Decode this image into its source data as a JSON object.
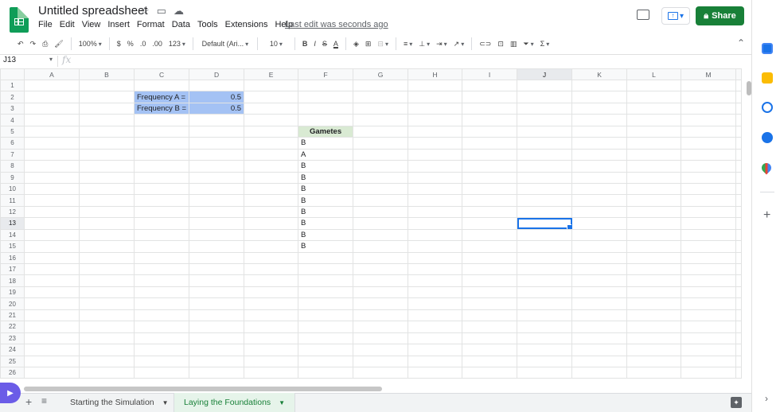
{
  "header": {
    "title": "Untitled spreadsheet",
    "menu": [
      "File",
      "Edit",
      "View",
      "Insert",
      "Format",
      "Data",
      "Tools",
      "Extensions",
      "Help"
    ],
    "last_edit": "Last edit was seconds ago",
    "share_label": "Share"
  },
  "toolbar": {
    "zoom": "100%",
    "currency": "$",
    "percent": "%",
    "decrease_decimal": ".0",
    "increase_decimal": ".00",
    "more_formats": "123",
    "font": "Default (Ari...",
    "font_size": "10",
    "bold": "B",
    "italic": "I",
    "strike": "S",
    "text_color": "A"
  },
  "formula_bar": {
    "name_box": "J13",
    "fx": "fx"
  },
  "grid": {
    "columns": [
      "A",
      "B",
      "C",
      "D",
      "E",
      "F",
      "G",
      "H",
      "I",
      "J",
      "K",
      "L",
      "M"
    ],
    "rows": [
      "1",
      "2",
      "3",
      "4",
      "5",
      "6",
      "7",
      "8",
      "9",
      "10",
      "11",
      "12",
      "13",
      "14",
      "15",
      "16",
      "17",
      "18",
      "19",
      "20",
      "21",
      "22",
      "23",
      "24",
      "25",
      "26"
    ],
    "selected_column": "J",
    "selected_row": "13",
    "cells": {
      "C2": "Frequency A =",
      "D2": "0.5",
      "C3": "Frequency B =",
      "D3": "0.5",
      "F5": "Gametes",
      "F6": "B",
      "F7": "A",
      "F8": "B",
      "F9": "B",
      "F10": "B",
      "F11": "B",
      "F12": "B",
      "F13": "B",
      "F14": "B",
      "F15": "B"
    }
  },
  "sheets": {
    "tabs": [
      {
        "label": "Starting the Simulation",
        "active": false
      },
      {
        "label": "Laying the Foundations",
        "active": true
      }
    ]
  },
  "colors": {
    "accent": "#1a73e8",
    "share": "#188038",
    "highlight_blue": "#a4c2f4",
    "header_green": "#d9ead3"
  }
}
